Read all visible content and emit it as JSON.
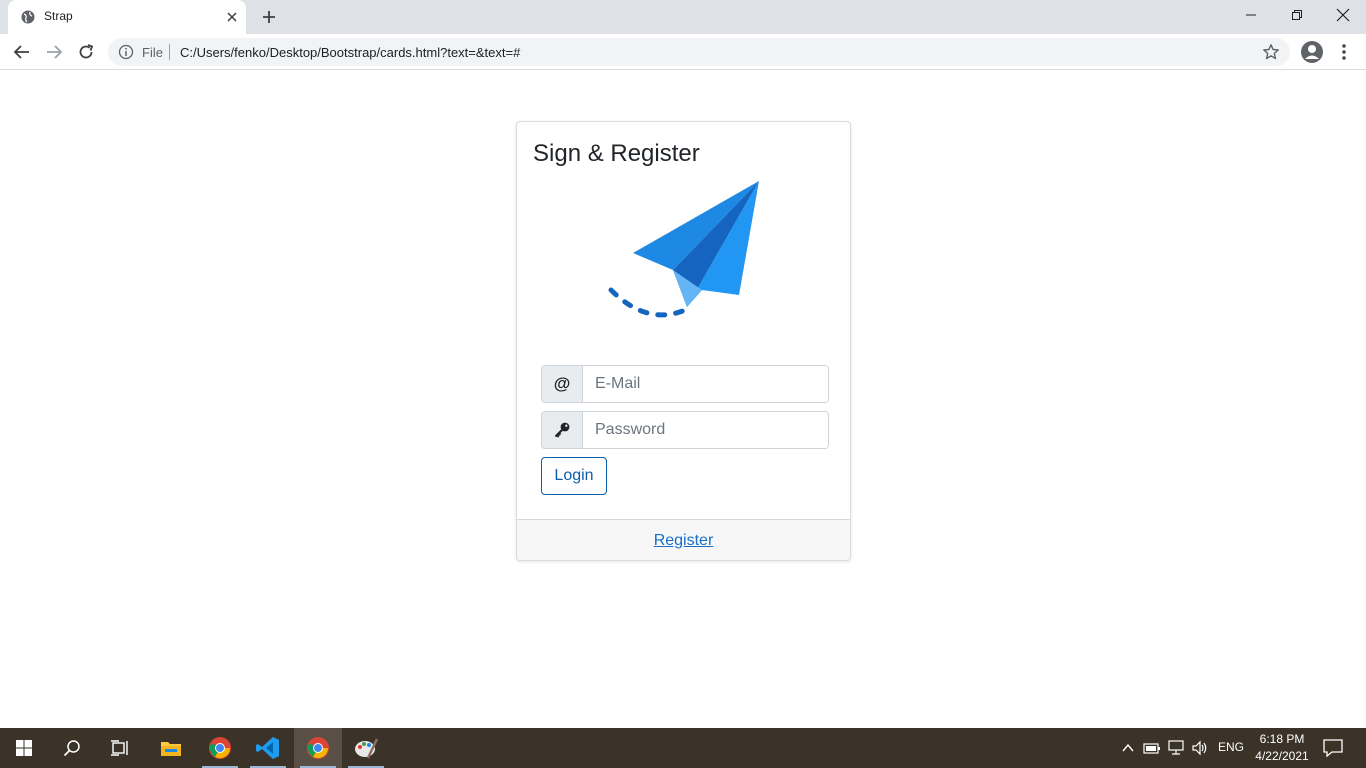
{
  "browser": {
    "tab_title": "Strap",
    "omnibox_label": "File",
    "url": "C:/Users/fenko/Desktop/Bootstrap/cards.html?text=&text=#",
    "icons": [
      "globe-icon",
      "close-icon",
      "plus-icon",
      "minimize-icon",
      "maximize-icon",
      "close-window-icon",
      "back-arrow-icon",
      "forward-arrow-icon",
      "reload-icon",
      "info-icon",
      "star-icon",
      "profile-icon",
      "kebab-menu-icon"
    ]
  },
  "card": {
    "title": "Sign & Register",
    "email_addon": "@",
    "email_placeholder": "E-Mail",
    "password_placeholder": "Password",
    "login_label": "Login",
    "register_label": "Register",
    "accent_color": "#1e88e5",
    "button_color": "#0d5ea8"
  },
  "taskbar": {
    "lang": "ENG",
    "time": "6:18 PM",
    "date": "4/22/2021",
    "apps": [
      "windows-start-icon",
      "search-icon",
      "task-view-icon",
      "file-explorer-icon",
      "chrome-icon",
      "vscode-icon",
      "chrome-icon",
      "paint-icon"
    ]
  }
}
